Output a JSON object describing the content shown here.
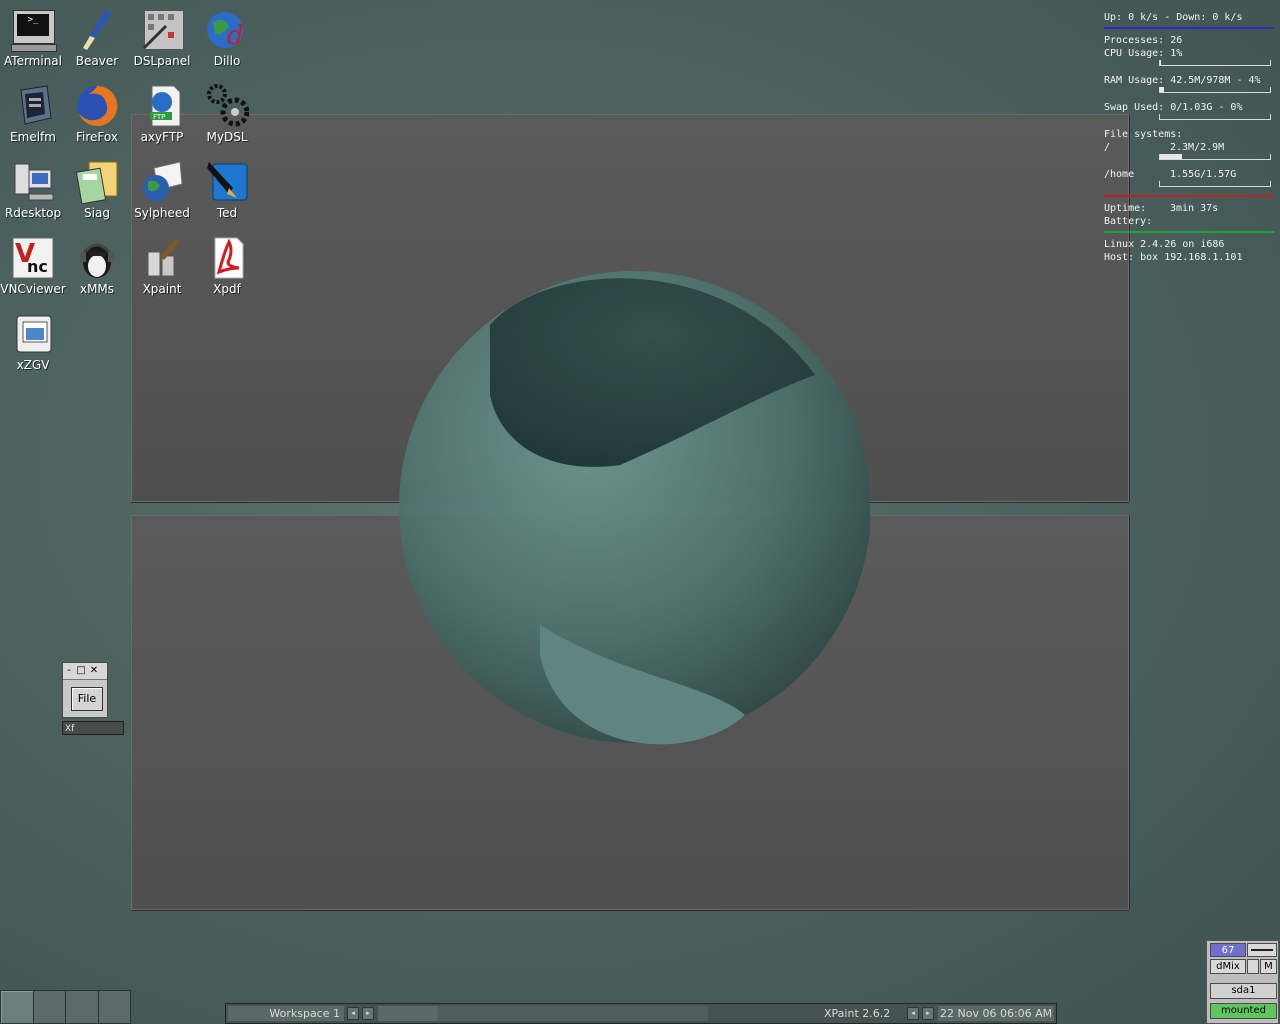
{
  "desktop": {
    "icons": [
      {
        "label": "ATerminal",
        "icon": "terminal-icon"
      },
      {
        "label": "Beaver",
        "icon": "paintbrush-icon"
      },
      {
        "label": "DSLpanel",
        "icon": "control-panel-icon"
      },
      {
        "label": "Dillo",
        "icon": "dillo-globe-icon"
      },
      {
        "label": "Emelfm",
        "icon": "file-manager-icon"
      },
      {
        "label": "FireFox",
        "icon": "firefox-icon"
      },
      {
        "label": "axyFTP",
        "icon": "ftp-icon"
      },
      {
        "label": "MyDSL",
        "icon": "gears-icon"
      },
      {
        "label": "Rdesktop",
        "icon": "remote-desktop-icon"
      },
      {
        "label": "Siag",
        "icon": "spreadsheet-calculator-icon"
      },
      {
        "label": "Sylpheed",
        "icon": "mail-globe-icon"
      },
      {
        "label": "Ted",
        "icon": "pen-icon"
      },
      {
        "label": "VNCviewer",
        "icon": "vnc-icon"
      },
      {
        "label": "xMMs",
        "icon": "penguin-headphones-icon"
      },
      {
        "label": "Xpaint",
        "icon": "paint-tools-icon"
      },
      {
        "label": "Xpdf",
        "icon": "pdf-icon"
      },
      {
        "label": "xZGV",
        "icon": "image-viewer-icon"
      }
    ]
  },
  "conky": {
    "network": "Up: 0 k/s - Down: 0 k/s",
    "processes": "Processes: 26",
    "cpu": "CPU Usage: 1%",
    "cpu_level": 0.01,
    "ram": "RAM Usage: 42.5M/978M - 4%",
    "ram_level": 0.04,
    "swap": "Swap Used: 0/1.03G - 0%",
    "swap_level": 0.0,
    "fs_header": "File systems:",
    "fs_root_label": "/",
    "fs_root_value": "2.3M/2.9M",
    "fs_root_level": 0.2,
    "fs_home_label": "/home",
    "fs_home_value": "1.55G/1.57G",
    "fs_home_level": 0.0,
    "uptime_label": "Uptime:",
    "uptime_value": "3min 37s",
    "battery_label": "Battery:",
    "kernel": "Linux 2.4.26 on i686",
    "host": "Host: box 192.168.1.101",
    "colors": {
      "rule_network": "#2c2cb8",
      "rule_fs": "#c02020",
      "rule_uptime": "#20a040"
    }
  },
  "miniwindow": {
    "file_button": "File",
    "label": "Xf"
  },
  "taskbar": {
    "workspace": "Workspace 1",
    "left_arrow": "◂",
    "right_arrow": "▸",
    "app": "XPaint 2.6.2",
    "clock": "22 Nov 06 06:06 AM"
  },
  "dockapp": {
    "volume": "67",
    "mixer": "dMix",
    "mode": "M",
    "device": "sda1",
    "status": "mounted"
  }
}
